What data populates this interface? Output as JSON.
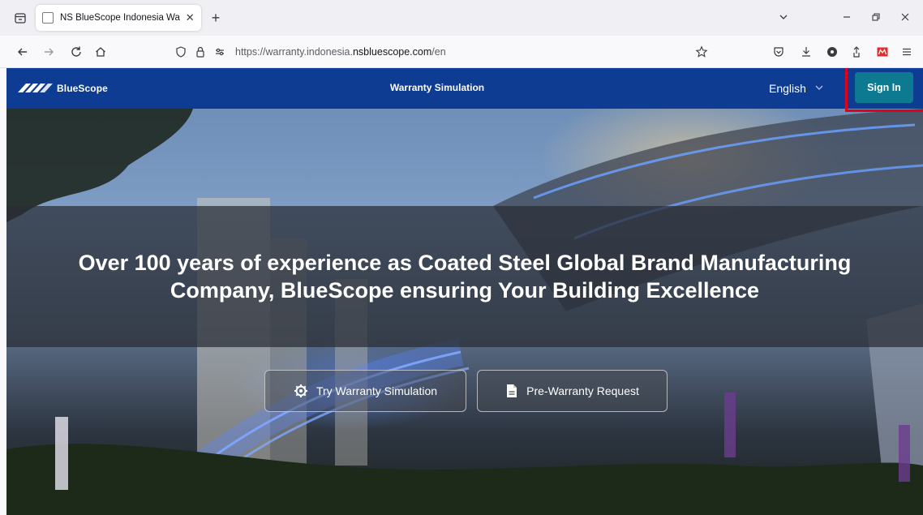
{
  "browser": {
    "tab_title": "NS BlueScope Indonesia Warranty",
    "tab_close": "✕",
    "new_tab": "+",
    "url_prefix": "https://warranty.indonesia.",
    "url_domain": "nsbluescope.com",
    "url_suffix": "/en",
    "window_controls": [
      "chevron-down-icon",
      "minimize-icon",
      "restore-icon",
      "close-icon"
    ]
  },
  "header": {
    "logo_text": "BlueScope",
    "nav_link": "Warranty Simulation",
    "language": "English",
    "sign_in": "Sign In"
  },
  "hero": {
    "title": "Over 100 years of experience as Coated Steel Global Brand Manufacturing Company, BlueScope ensuring Your Building Excellence",
    "cta_primary": "Try Warranty Simulation",
    "cta_secondary": "Pre-Warranty Request"
  },
  "colors": {
    "header_bg": "#0e3c93",
    "sign_in_bg": "#0d7a92",
    "highlight": "#e3001b"
  }
}
